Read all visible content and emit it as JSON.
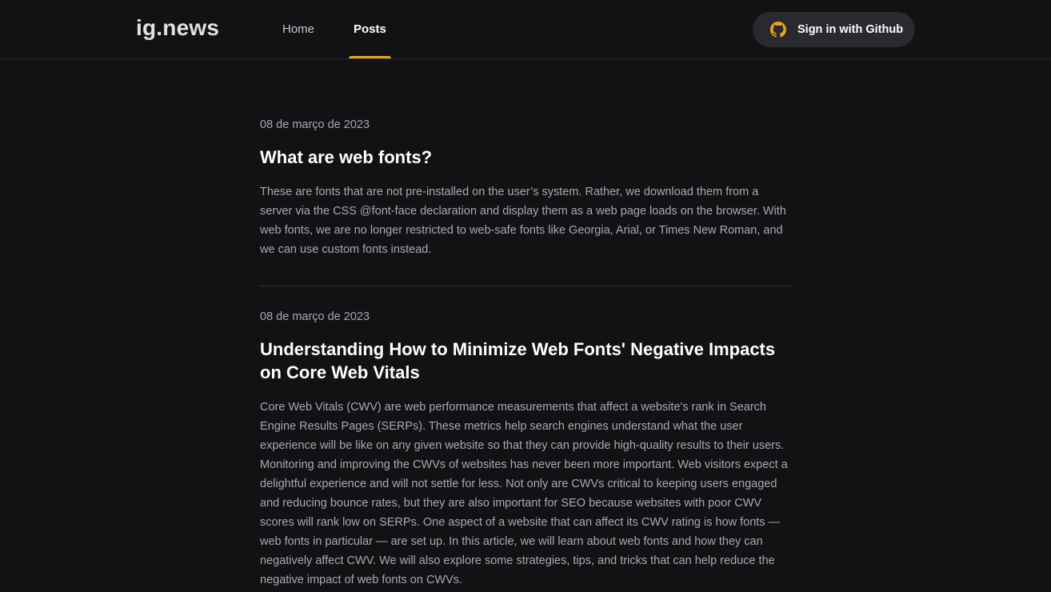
{
  "header": {
    "logo": "ig.news",
    "nav": [
      {
        "label": "Home",
        "active": false
      },
      {
        "label": "Posts",
        "active": true
      }
    ],
    "signin_label": "Sign in with Github",
    "signin_icon": "github-icon",
    "accent_color": "#eba417"
  },
  "posts": [
    {
      "date": "08 de março de 2023",
      "title": "What are web fonts?",
      "excerpt": "These are fonts that are not pre-installed on the user’s system. Rather, we download them from a server via the CSS @font-face declaration and display them as a web page loads on the browser. With web fonts, we are no longer restricted to web-safe fonts like Georgia, Arial, or Times New Roman, and we can use custom fonts instead."
    },
    {
      "date": "08 de março de 2023",
      "title": "Understanding How to Minimize Web Fonts' Negative Impacts on Core Web Vitals",
      "excerpt": "Core Web Vitals (CWV) are web performance measurements that affect a website's rank in Search Engine Results Pages (SERPs). These metrics help search engines understand what the user experience will be like on any given website so that they can provide high-quality results to their users. Monitoring and improving the CWVs of websites has never been more important. Web visitors expect a delightful experience and will not settle for less. Not only are CWVs critical to keeping users engaged and reducing bounce rates, but they are also important for SEO because websites with poor CWV scores will rank low on SERPs. One aspect of a website that can affect its CWV rating is how fonts — web fonts in particular — are set up. In this article, we will learn about web fonts and how they can negatively affect CWV. We will also explore some strategies, tips, and tricks that can help reduce the negative impact of web fonts on CWVs."
    }
  ]
}
